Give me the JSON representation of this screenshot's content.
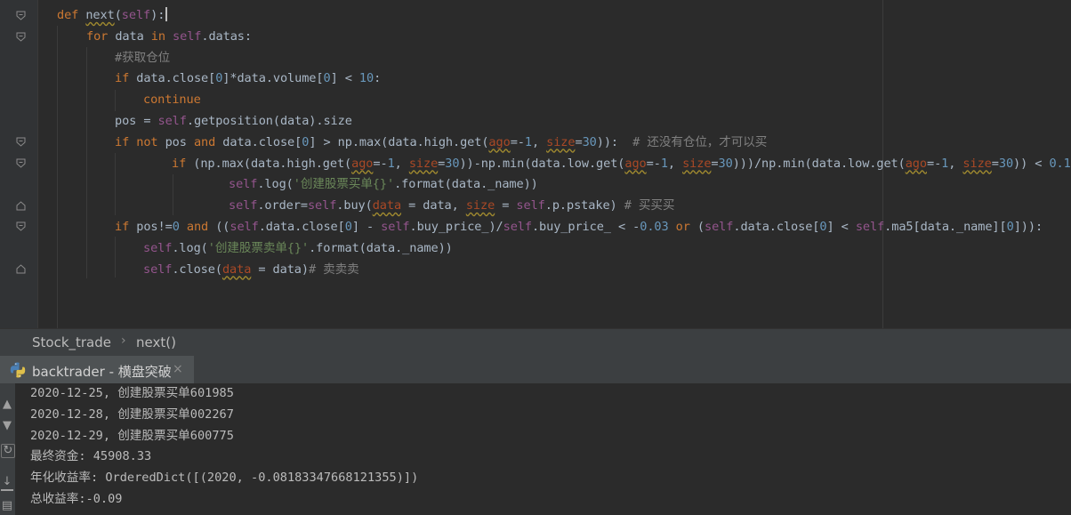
{
  "editor": {
    "lines": [
      {
        "parts": [
          [
            "kw",
            "def "
          ],
          [
            "fn",
            "next"
          ],
          [
            "t",
            "("
          ],
          [
            "self",
            "self"
          ],
          [
            "t",
            ")"
          ],
          [
            "t",
            ":"
          ]
        ],
        "cursor": true
      },
      {
        "parts": [
          [
            "kw",
            "for "
          ],
          [
            "t",
            "data "
          ],
          [
            "kw",
            "in "
          ],
          [
            "self",
            "self"
          ],
          [
            "t",
            ".datas:"
          ]
        ]
      },
      {
        "parts": [
          [
            "cm",
            "#获取仓位"
          ]
        ]
      },
      {
        "parts": [
          [
            "kw",
            "if "
          ],
          [
            "t",
            "data.close["
          ],
          [
            "num",
            "0"
          ],
          [
            "t",
            "]*data.volume["
          ],
          [
            "num",
            "0"
          ],
          [
            "t",
            "] < "
          ],
          [
            "num",
            "10"
          ],
          [
            "t",
            ":"
          ]
        ]
      },
      {
        "parts": [
          [
            "kw",
            "continue"
          ]
        ]
      },
      {
        "parts": [
          [
            "t",
            "pos = "
          ],
          [
            "self",
            "self"
          ],
          [
            "t",
            ".getposition(data).size"
          ]
        ]
      },
      {
        "parts": [
          [
            "kw",
            "if not "
          ],
          [
            "t",
            "pos "
          ],
          [
            "kw",
            "and "
          ],
          [
            "t",
            "data.close["
          ],
          [
            "num",
            "0"
          ],
          [
            "t",
            "] > np.max(data.high.get("
          ],
          [
            "param",
            "ago"
          ],
          [
            "t",
            "=-"
          ],
          [
            "num",
            "1"
          ],
          [
            "t",
            ", "
          ],
          [
            "param",
            "size"
          ],
          [
            "t",
            "="
          ],
          [
            "num",
            "30"
          ],
          [
            "t",
            "))"
          ],
          [
            "t",
            ":  "
          ],
          [
            "cm",
            "# 还没有仓位，才可以买"
          ]
        ]
      },
      {
        "parts": [
          [
            "kw",
            "if "
          ],
          [
            "t",
            "(np.max(data.high.get("
          ],
          [
            "param",
            "ago"
          ],
          [
            "t",
            "=-"
          ],
          [
            "num",
            "1"
          ],
          [
            "t",
            ", "
          ],
          [
            "param",
            "size"
          ],
          [
            "t",
            "="
          ],
          [
            "num",
            "30"
          ],
          [
            "t",
            "))-np.min(data.low.get("
          ],
          [
            "param",
            "ago"
          ],
          [
            "t",
            "=-"
          ],
          [
            "num",
            "1"
          ],
          [
            "t",
            ", "
          ],
          [
            "param",
            "size"
          ],
          [
            "t",
            "="
          ],
          [
            "num",
            "30"
          ],
          [
            "t",
            ")))/np.min(data.low.get("
          ],
          [
            "param",
            "ago"
          ],
          [
            "t",
            "=-"
          ],
          [
            "num",
            "1"
          ],
          [
            "t",
            ", "
          ],
          [
            "param",
            "size"
          ],
          [
            "t",
            "="
          ],
          [
            "num",
            "30"
          ],
          [
            "t",
            ")) < "
          ],
          [
            "num",
            "0.1"
          ],
          [
            "t",
            ":"
          ]
        ]
      },
      {
        "parts": [
          [
            "self",
            "self"
          ],
          [
            "t",
            ".log("
          ],
          [
            "str",
            "'创建股票买单{}'"
          ],
          [
            "t",
            ".format(data._name))"
          ]
        ]
      },
      {
        "parts": [
          [
            "self",
            "self"
          ],
          [
            "t",
            ".order="
          ],
          [
            "self",
            "self"
          ],
          [
            "t",
            ".buy("
          ],
          [
            "param",
            "data"
          ],
          [
            "t",
            " = data, "
          ],
          [
            "param",
            "size"
          ],
          [
            "t",
            " = "
          ],
          [
            "self",
            "self"
          ],
          [
            "t",
            ".p.pstake)"
          ],
          [
            "cm",
            " # 买买买"
          ]
        ]
      },
      {
        "parts": [
          [
            "kw",
            "if "
          ],
          [
            "t",
            "pos!="
          ],
          [
            "num",
            "0 "
          ],
          [
            "kw",
            "and "
          ],
          [
            "t",
            "(("
          ],
          [
            "self",
            "self"
          ],
          [
            "t",
            ".data.close["
          ],
          [
            "num",
            "0"
          ],
          [
            "t",
            "] - "
          ],
          [
            "self",
            "self"
          ],
          [
            "t",
            ".buy_price_)/"
          ],
          [
            "self",
            "self"
          ],
          [
            "t",
            ".buy_price_ < -"
          ],
          [
            "num",
            "0.03 "
          ],
          [
            "kw",
            "or "
          ],
          [
            "t",
            "("
          ],
          [
            "self",
            "self"
          ],
          [
            "t",
            ".data.close["
          ],
          [
            "num",
            "0"
          ],
          [
            "t",
            "] < "
          ],
          [
            "self",
            "self"
          ],
          [
            "t",
            ".ma5[data._name]["
          ],
          [
            "num",
            "0"
          ],
          [
            "t",
            "])):"
          ]
        ]
      },
      {
        "parts": [
          [
            "self",
            "self"
          ],
          [
            "t",
            ".log("
          ],
          [
            "str",
            "'创建股票卖单{}'"
          ],
          [
            "t",
            ".format(data._name))"
          ]
        ]
      },
      {
        "parts": [
          [
            "self",
            "self"
          ],
          [
            "t",
            ".close("
          ],
          [
            "param",
            "data"
          ],
          [
            "t",
            " = data)"
          ],
          [
            "cm",
            "# 卖卖卖"
          ]
        ]
      }
    ]
  },
  "breadcrumb": {
    "file": "Stock_trade",
    "func": "next()",
    "sep": "›"
  },
  "run": {
    "title": "backtrader - 横盘突破",
    "close": "×"
  },
  "console": {
    "lines": [
      "2020-12-25, 创建股票买单601985",
      "2020-12-28, 创建股票买单002267",
      "2020-12-29, 创建股票买单600775",
      "最终资金: 45908.33",
      "年化收益率: OrderedDict([(2020, -0.08183347668121355)])",
      "总收益率:-0.09"
    ]
  },
  "icons": {
    "python": "python-icon",
    "scroll_up": "scroll-up-icon",
    "scroll_end": "scroll-to-end-icon"
  }
}
